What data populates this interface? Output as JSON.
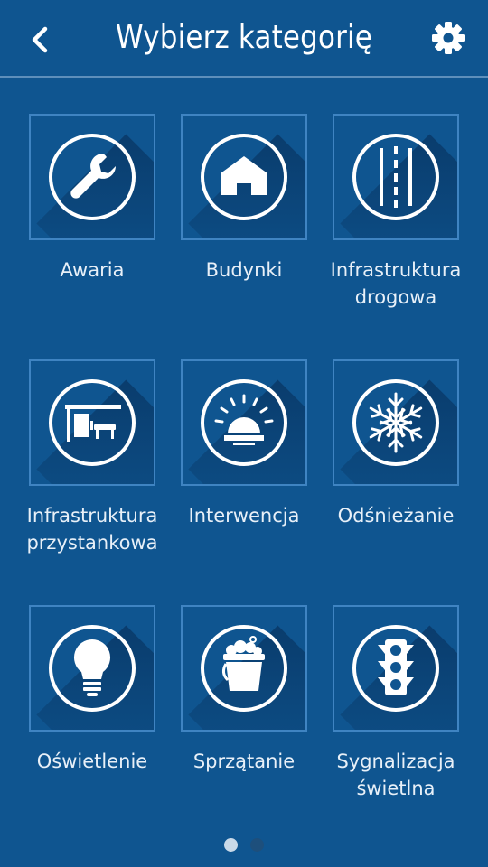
{
  "header": {
    "title": "Wybierz kategorię"
  },
  "categories": [
    {
      "label": "Awaria",
      "icon": "wrench-icon"
    },
    {
      "label": "Budynki",
      "icon": "house-icon"
    },
    {
      "label": "Infrastruktura\ndrogowa",
      "icon": "road-icon"
    },
    {
      "label": "Infrastruktura\nprzystankowa",
      "icon": "bus-stop-icon"
    },
    {
      "label": "Interwencja",
      "icon": "siren-icon"
    },
    {
      "label": "Odśnieżanie",
      "icon": "snowflake-icon"
    },
    {
      "label": "Oświetlenie",
      "icon": "lightbulb-icon"
    },
    {
      "label": "Sprzątanie",
      "icon": "bucket-icon"
    },
    {
      "label": "Sygnalizacja\nświetlna",
      "icon": "traffic-light-icon"
    }
  ],
  "pagination": {
    "pages": 2,
    "current": 1
  },
  "colors": {
    "background": "#0f5590",
    "tile_border": "#3f84c2",
    "divider": "#5e8fbb"
  }
}
